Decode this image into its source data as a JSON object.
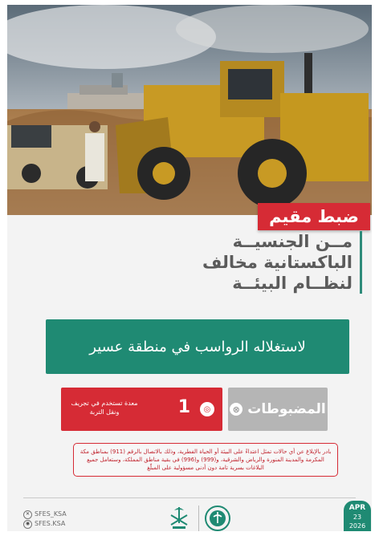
{
  "tag": "ضبط مقيم",
  "headline": {
    "line1": "مــن الجنسيــة",
    "line2": "الباكستانية مخالف",
    "line3": "لنظــام البيئــة"
  },
  "banner": "لاستغلاله الرواسب في منطقة عسير",
  "seized": {
    "label": "المضبوطات",
    "count": "1",
    "description": "معدة تستخدم في تجريف ونقل التربة"
  },
  "notice": "بادر بالإبلاغ عن أي حالات تمثل اعتداءً على البيئة أو الحياة الفطرية، وذلك بالاتصال بالرقم (911) بمناطق مكة المكرمة والمدينة المنورة والرياض والشرقية، و(999) و(996) في بقية مناطق المملكة، وستعامل جميع البلاغات بسرية تامة دون أدنى مسؤولية على المبلّغ",
  "socials": [
    "SFES_KSA",
    "SFES.KSA"
  ],
  "date": {
    "month": "APR",
    "day": "23",
    "year": "2026"
  },
  "icons": {
    "x": "x-icon",
    "snapchat": "snapchat-icon",
    "handcuffs": "handcuffs-icon",
    "stat": "loader-icon",
    "emblem": "saudi-emblem-icon",
    "agency": "environment-security-logo"
  },
  "colors": {
    "red": "#d62b35",
    "green": "#1f8a73",
    "gray": "#b5b5b5"
  }
}
